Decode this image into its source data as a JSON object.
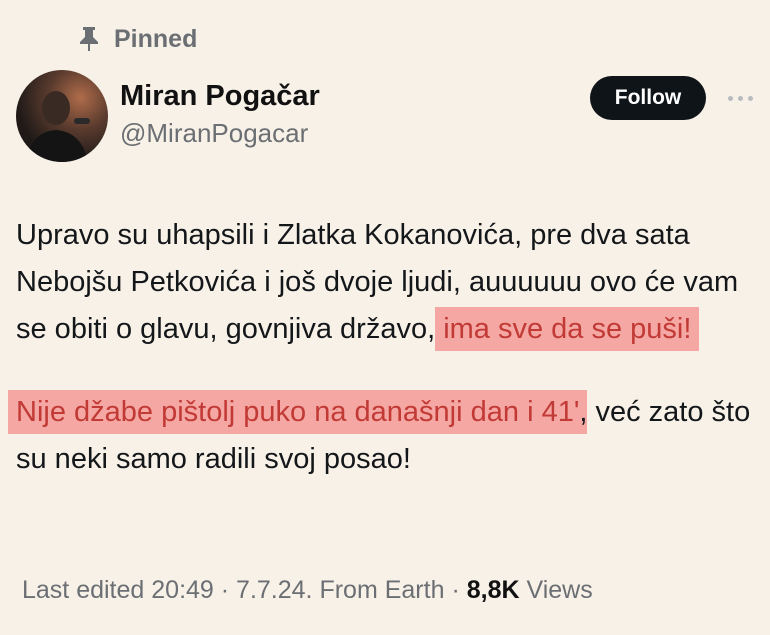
{
  "pinned_label": "Pinned",
  "author": {
    "name": "Miran Pogačar",
    "handle": "@MiranPogacar"
  },
  "follow_label": "Follow",
  "tweet": {
    "p1_plain": "Upravo su uhapsili i Zlatka Kokanovića, pre dva sata Nebojšu Petkovića i još dvoje ljudi, auuuuuu ovo će vam se obiti o glavu, govnjiva državo, ",
    "p1_highlight": "ima sve da se puši!",
    "p2_highlight": "Nije džabe pištolj puko na današnji dan i 41'",
    "p2_plain": ", već zato što su neki samo radili svoj posao!"
  },
  "meta": {
    "edited": "Last edited 20:49 · 7.7.24.",
    "source": "From Earth",
    "sep": "·",
    "views_count": "8,8K",
    "views_label": "Views"
  },
  "colors": {
    "background": "#f8f1e8",
    "highlight_bg": "#f4a7a3",
    "highlight_text": "#c23a36",
    "follow_bg": "#0f1419"
  }
}
